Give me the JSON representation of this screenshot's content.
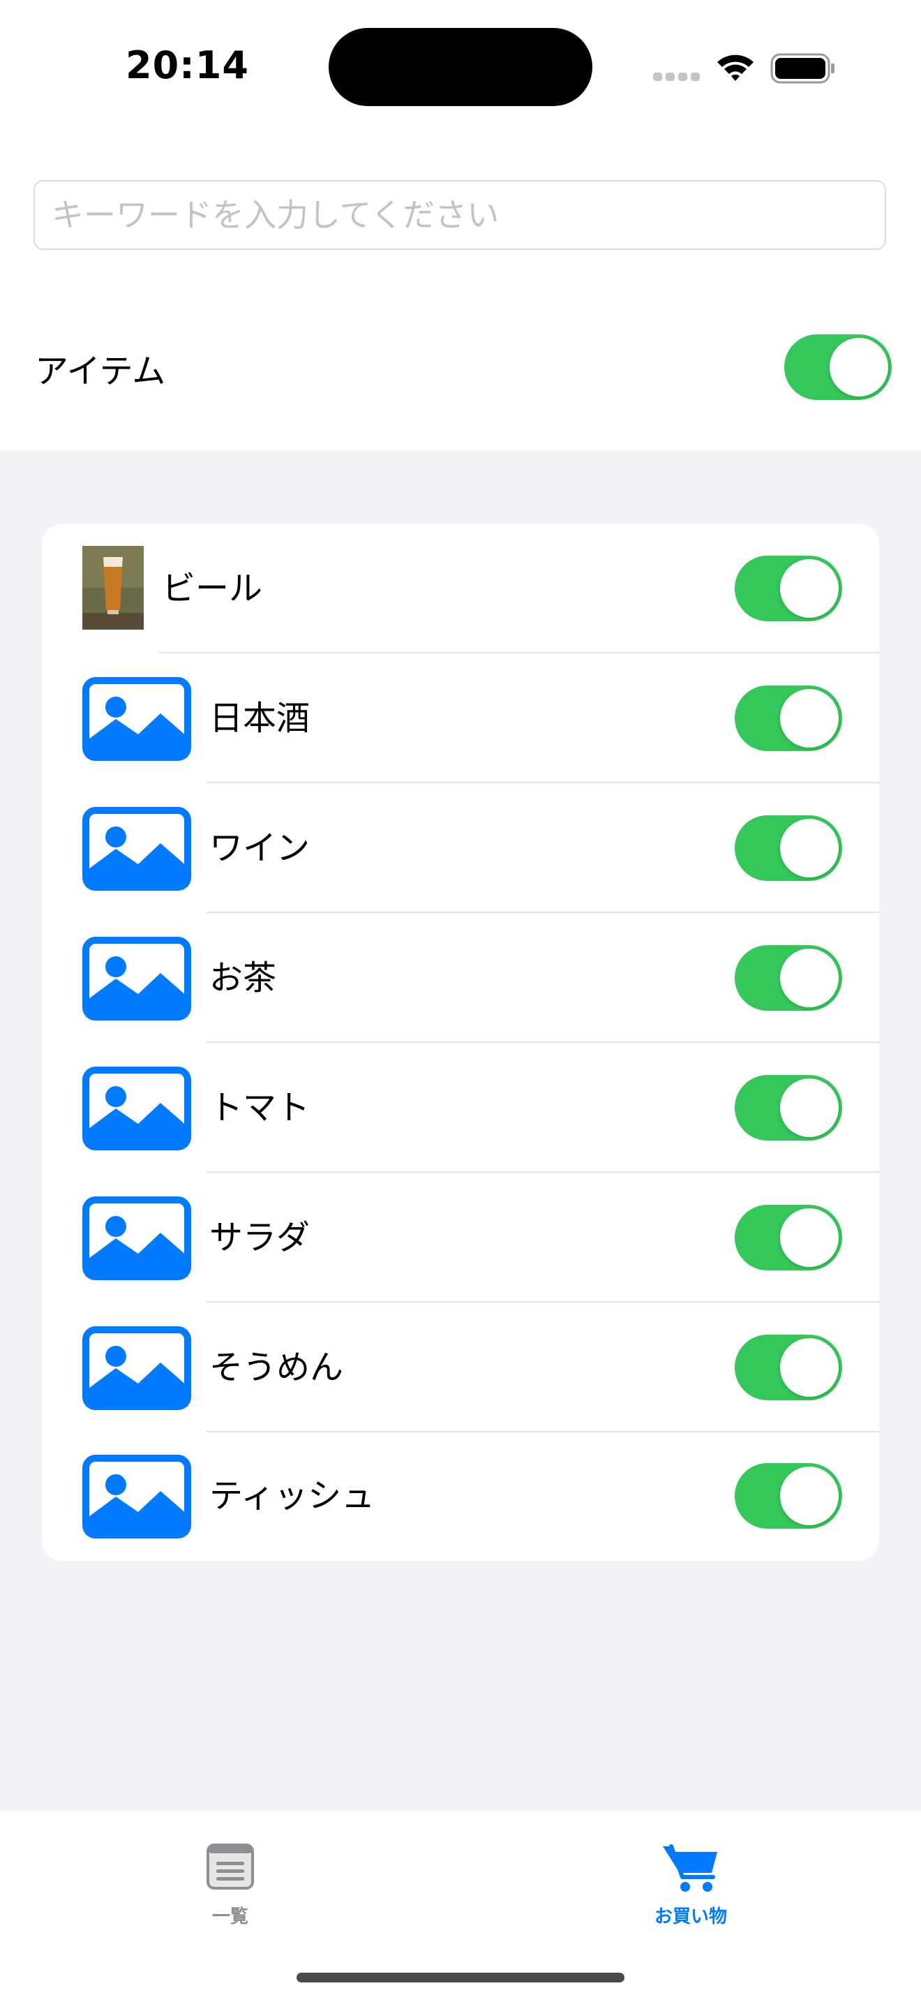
{
  "status_bar": {
    "time": "20:14"
  },
  "search": {
    "placeholder": "キーワードを入力してください",
    "value": ""
  },
  "section": {
    "label": "アイテム",
    "enabled": true
  },
  "items": [
    {
      "name": "ビール",
      "image": "beer-photo",
      "enabled": true
    },
    {
      "name": "日本酒",
      "image": "photo-placeholder-icon",
      "enabled": true
    },
    {
      "name": "ワイン",
      "image": "photo-placeholder-icon",
      "enabled": true
    },
    {
      "name": "お茶",
      "image": "photo-placeholder-icon",
      "enabled": true
    },
    {
      "name": "トマト",
      "image": "photo-placeholder-icon",
      "enabled": true
    },
    {
      "name": "サラダ",
      "image": "photo-placeholder-icon",
      "enabled": true
    },
    {
      "name": "そうめん",
      "image": "photo-placeholder-icon",
      "enabled": true
    },
    {
      "name": "ティッシュ",
      "image": "photo-placeholder-icon",
      "enabled": true
    }
  ],
  "tab_bar": {
    "tabs": [
      {
        "label": "一覧",
        "icon": "list-icon",
        "selected": false
      },
      {
        "label": "お買い物",
        "icon": "cart-icon",
        "selected": true
      }
    ]
  },
  "colors": {
    "accent": "#007aff",
    "toggle_on": "#34c759",
    "grouped_background": "#f2f2f7",
    "tab_inactive": "#8e8e93"
  }
}
